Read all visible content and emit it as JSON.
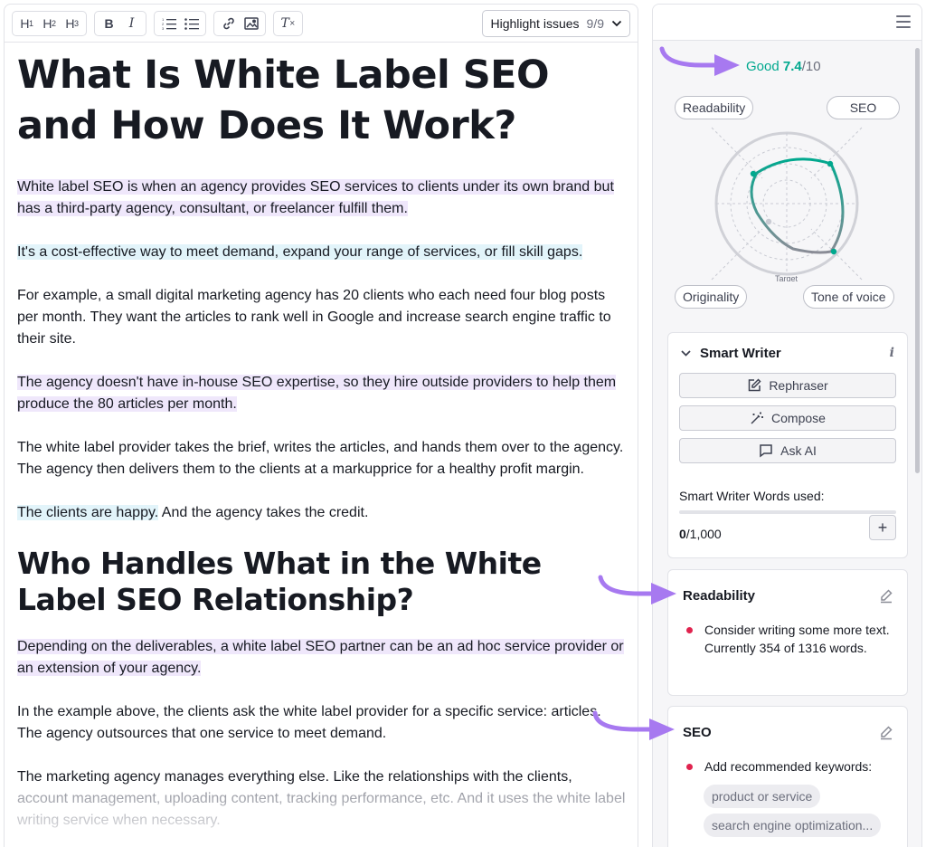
{
  "toolbar": {
    "h1_label": "H",
    "h1_sub": "1",
    "h2_label": "H",
    "h2_sub": "2",
    "h3_label": "H",
    "h3_sub": "3",
    "bold_label": "B",
    "italic_label": "I",
    "clear_label": "T",
    "highlight_label": "Highlight issues",
    "highlight_count": "9/9"
  },
  "article": {
    "title": "What Is White Label SEO and How Does It Work?",
    "paragraphs": [
      {
        "segments": [
          {
            "text": "White label SEO is when an agency provides SEO services to clients under its own brand but has a third-party agency, consultant, or freelancer fulfill them.",
            "hl": "purple"
          }
        ]
      },
      {
        "segments": [
          {
            "text": "It's a cost-effective way to meet demand, expand your range of services, or fill skill gaps.",
            "hl": "blue"
          }
        ]
      },
      {
        "segments": [
          {
            "text": "For example, a small digital marketing agency has 20 clients who each need four blog posts per month. They want the articles to rank well in Google and increase search engine traffic to their site.",
            "hl": ""
          }
        ]
      },
      {
        "segments": [
          {
            "text": "The agency doesn't have in-house SEO expertise, so they hire outside providers to help them produce the 80 articles per month.",
            "hl": "purple"
          }
        ]
      },
      {
        "segments": [
          {
            "text": "The white label provider takes the brief, writes the articles, and hands them over to the agency. The agency then delivers them to the clients at a markupprice for a healthy profit margin.",
            "hl": ""
          }
        ]
      },
      {
        "segments": [
          {
            "text": "The clients are happy.",
            "hl": "blue"
          },
          {
            "text": " And the agency takes the credit.",
            "hl": ""
          }
        ]
      }
    ],
    "subheading": "Who Handles What in the White Label SEO Relationship?",
    "paragraphs2": [
      {
        "segments": [
          {
            "text": "Depending on the deliverables, a white label SEO partner can be an ad hoc service provider or an extension of your agency.",
            "hl": "purple"
          }
        ]
      },
      {
        "segments": [
          {
            "text": "In the example above, the clients ask the white label provider for a specific service: articles. The agency outsources that one service to meet demand.",
            "hl": ""
          }
        ]
      },
      {
        "segments": [
          {
            "text": "The marketing agency manages everything else. Like the relationships with the clients, ",
            "hl": ""
          },
          {
            "text": "account management, uploading content, tracking performance, etc. And it uses the white label writing service when necessary.",
            "hl": "faded"
          }
        ]
      }
    ]
  },
  "sidebar": {
    "score_word": "Good",
    "score_value": "7.4",
    "score_max": "/10",
    "radar_labels": {
      "readability": "Readability",
      "seo": "SEO",
      "originality": "Originality",
      "tone": "Tone of voice",
      "target": "Target"
    },
    "smart_writer": {
      "title": "Smart Writer",
      "info": "i",
      "buttons": [
        "Rephraser",
        "Compose",
        "Ask AI"
      ],
      "words_label": "Smart Writer Words used:",
      "used": "0",
      "limit": "/1,000",
      "add": "+",
      "usage_fraction": 0
    },
    "readability": {
      "title": "Readability",
      "issue": "Consider writing some more text. Currently 354 of 1316 words."
    },
    "seo": {
      "title": "SEO",
      "issue": "Add recommended keywords:",
      "keywords": [
        "product or service",
        "search engine optimization..."
      ]
    }
  },
  "colors": {
    "accent_green": "#00a88e",
    "highlight_purple": "#efe7fb",
    "highlight_blue": "#e2f4fa",
    "issue_red": "#e0234e",
    "arrow_purple": "#a779f0"
  }
}
